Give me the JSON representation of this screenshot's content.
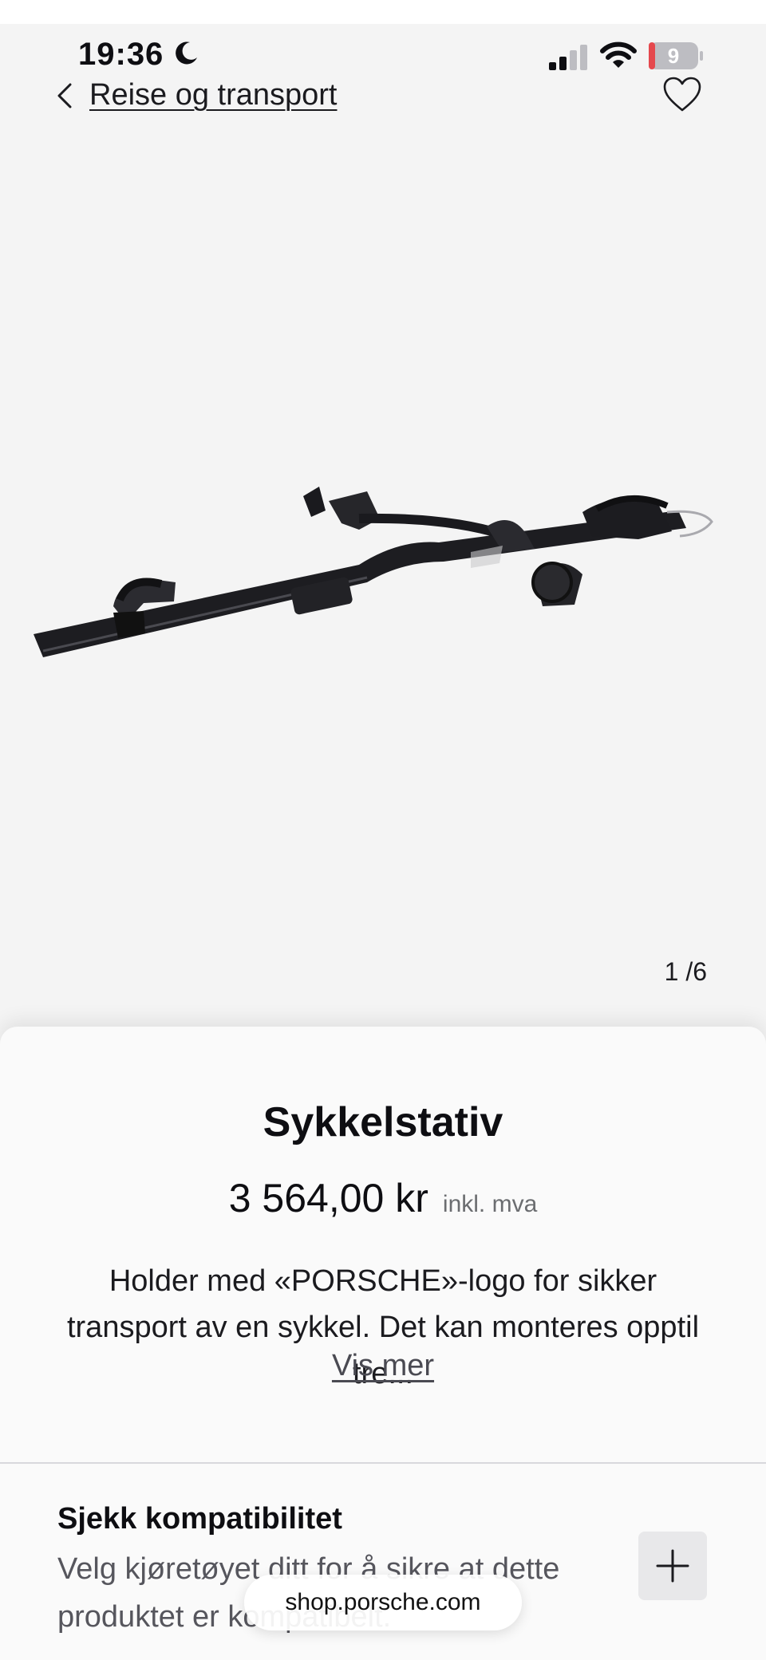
{
  "status_bar": {
    "time": "19:36",
    "battery": "9",
    "icons": [
      "moon-icon",
      "signal-icon",
      "wifi-icon",
      "battery-icon"
    ]
  },
  "nav": {
    "back_icon": "chevron-left-icon",
    "breadcrumb": "Reise og transport",
    "favorite_icon": "heart-icon"
  },
  "gallery": {
    "counter": "1 /6"
  },
  "product": {
    "title": "Sykkelstativ",
    "price": "3 564,00 kr",
    "vat_note": "inkl. mva",
    "description": "Holder med «PORSCHE»-logo for sikker transport av en sykkel. Det kan monteres opptil tre...",
    "more_link": "Vis mer"
  },
  "compatibility": {
    "title": "Sjekk kompatibilitet",
    "text": "Velg kjøretøyet ditt for å sikre at dette produktet er kompatibelt.",
    "expand_icon": "plus-icon"
  },
  "browser": {
    "url": "shop.porsche.com"
  },
  "colors": {
    "background": "#f4f4f4",
    "card": "#fafafa",
    "text": "#0e0e12",
    "battery_low": "#e5484d"
  }
}
